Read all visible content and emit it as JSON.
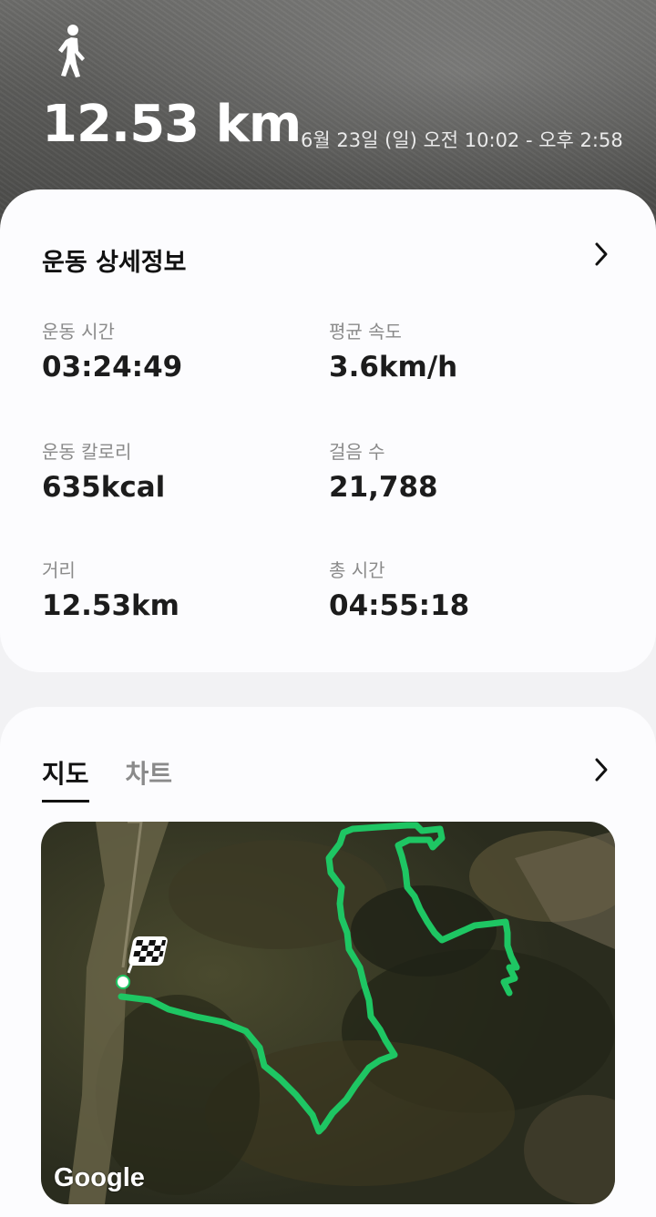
{
  "header": {
    "activity_icon": "walking-person-icon",
    "distance": "12.53 km",
    "datetime": "6월 23일 (일) 오전 10:02 - 오후 2:58"
  },
  "details": {
    "title": "운동 상세정보",
    "stats": [
      {
        "label": "운동 시간",
        "value": "03:24:49"
      },
      {
        "label": "평균 속도",
        "value": "3.6km/h"
      },
      {
        "label": "운동 칼로리",
        "value": "635kcal"
      },
      {
        "label": "걸음 수",
        "value": "21,788"
      },
      {
        "label": "거리",
        "value": "12.53km"
      },
      {
        "label": "총 시간",
        "value": "04:55:18"
      }
    ]
  },
  "map_section": {
    "tabs": [
      {
        "label": "지도",
        "active": true
      },
      {
        "label": "차트",
        "active": false
      }
    ],
    "map_attribution": "Google"
  },
  "colors": {
    "route": "#1ec663",
    "card_bg": "#fcfcfe",
    "page_bg": "#f2f2f4"
  }
}
